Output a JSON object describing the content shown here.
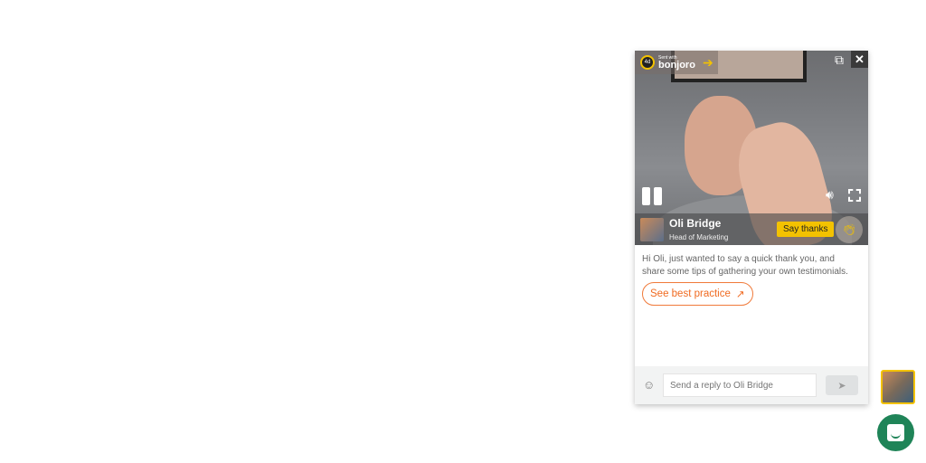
{
  "widget": {
    "brand": {
      "sent_with": "Sent with",
      "name": "bonjoro",
      "logo_text": "4d"
    },
    "sender": {
      "name": "Oli Bridge",
      "role": "Head of Marketing"
    },
    "say_thanks": "Say thanks",
    "message": "Hi Oli, just wanted to say a quick thank you, and share some tips of gathering your own testimonials.",
    "cta": "See best practice",
    "reply_placeholder": "Send a reply to Oli Bridge"
  }
}
